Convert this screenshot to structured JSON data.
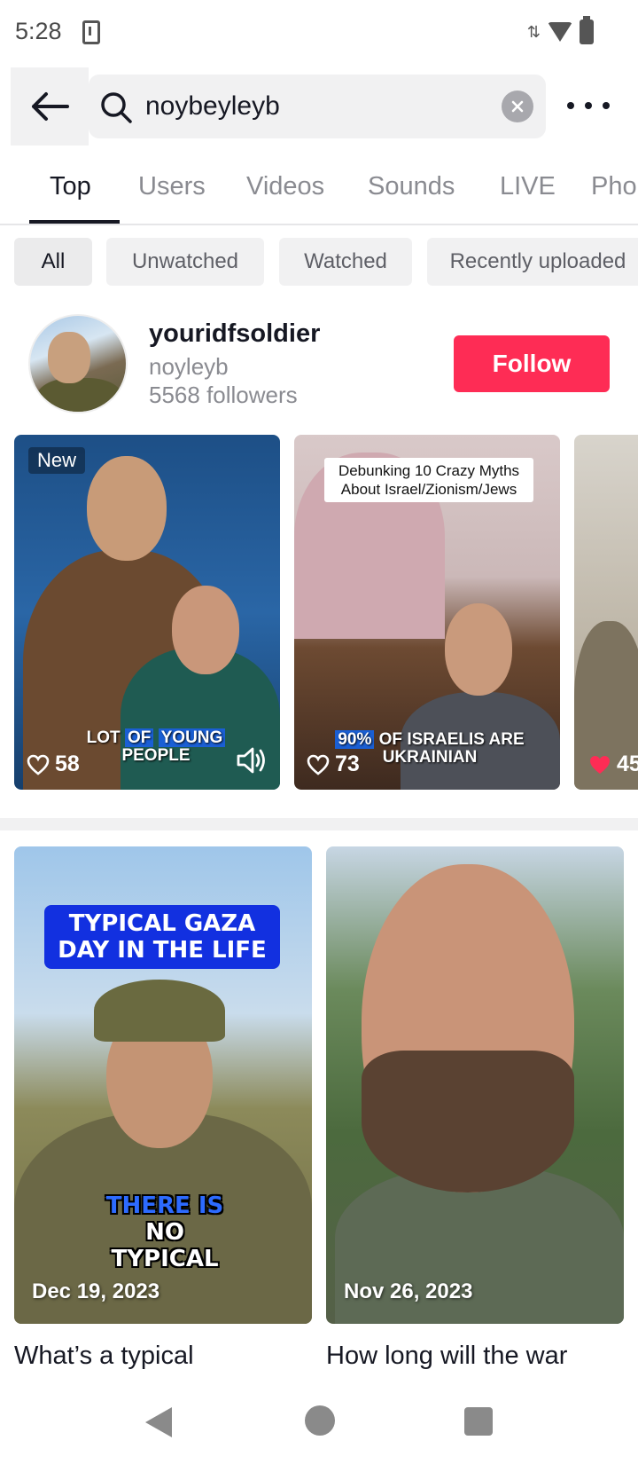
{
  "status_bar": {
    "time": "5:28"
  },
  "search": {
    "query": "noybeyleyb"
  },
  "tabs": [
    "Top",
    "Users",
    "Videos",
    "Sounds",
    "LIVE",
    "Pho"
  ],
  "filters": [
    "All",
    "Unwatched",
    "Watched",
    "Recently uploaded"
  ],
  "user": {
    "username": "youridfsoldier",
    "nickname": "noyleyb",
    "followers": "5568 followers",
    "follow_label": "Follow"
  },
  "carousel": [
    {
      "badge": "New",
      "likes": "58",
      "caption_pre": "LOT ",
      "caption_hl1": "OF",
      "caption_hl2": "YOUNG",
      "caption_post": "PEOPLE"
    },
    {
      "title": "Debunking 10 Crazy Myths About Israel/Zionism/Jews",
      "likes": "73",
      "caption_hl": "90%",
      "caption_post": "OF ISRAELIS ARE UKRAINIAN"
    },
    {
      "likes": "45"
    }
  ],
  "videos": [
    {
      "banner": "TYPICAL GAZA DAY IN THE LIFE",
      "overlay_hl": "THERE IS",
      "overlay_rest": "NO TYPICAL",
      "date": "Dec 19, 2023",
      "title": "What’s a typical"
    },
    {
      "date": "Nov 26, 2023",
      "title": "How long will the war"
    }
  ],
  "colors": {
    "accent": "#fe2c55",
    "caption_highlight": "#1a5fd4",
    "banner_blue": "#1230e0"
  }
}
